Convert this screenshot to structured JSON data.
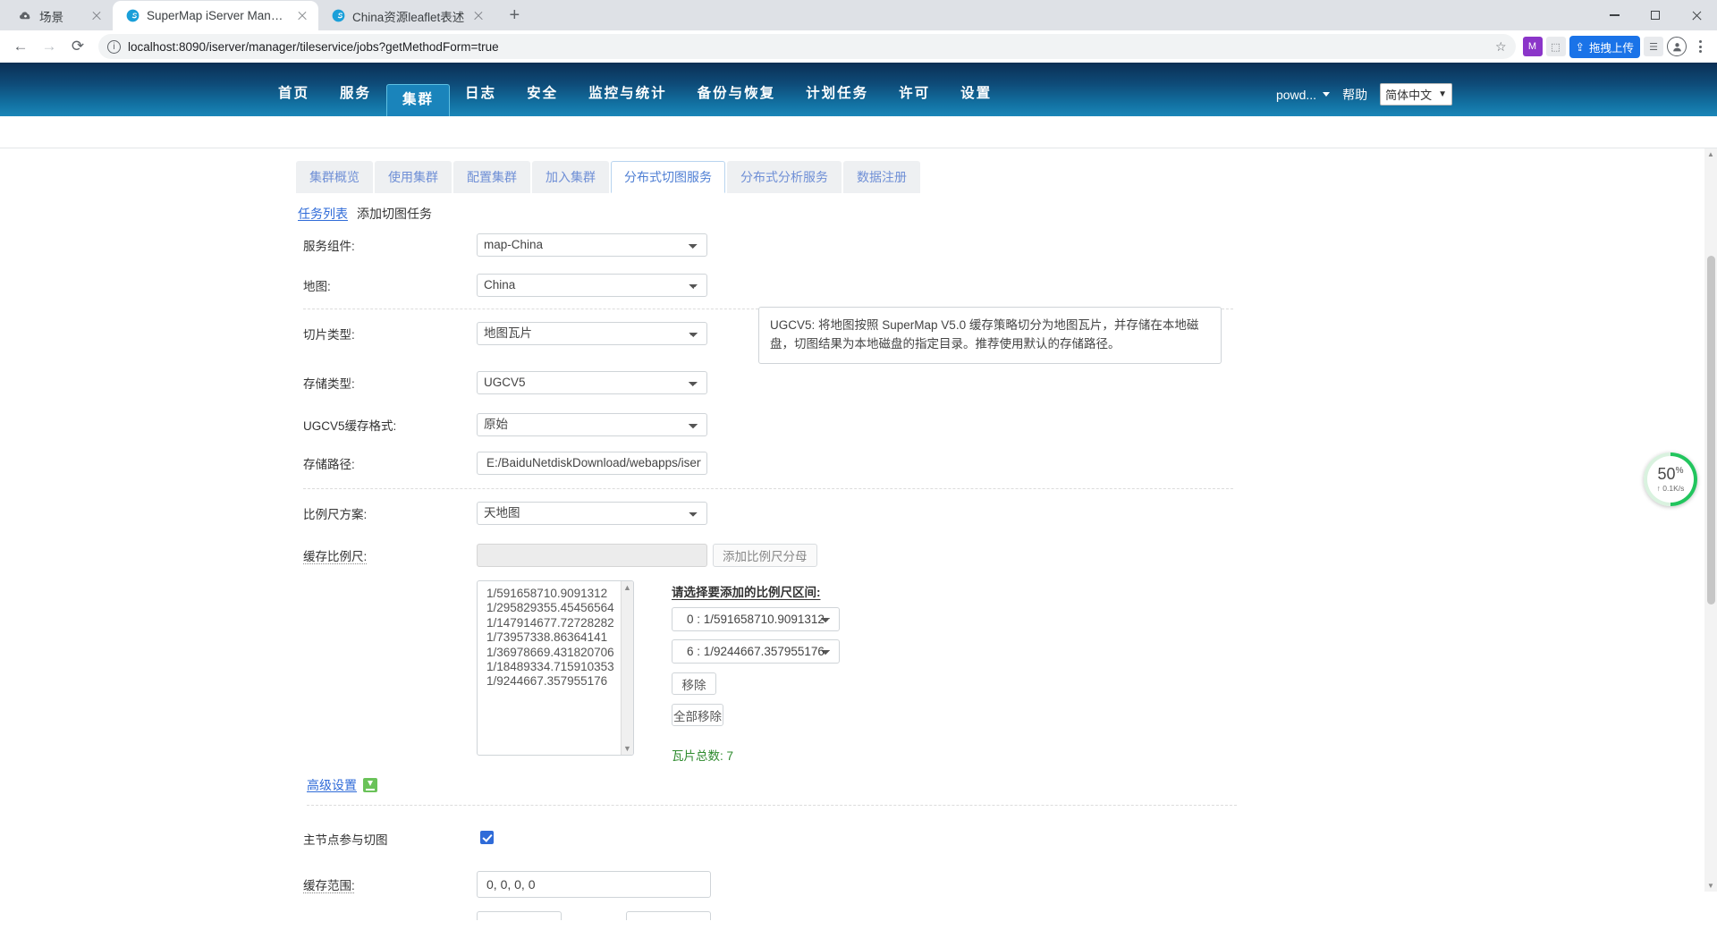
{
  "browser": {
    "tabs": [
      {
        "title": "场景",
        "favicon": "cloud-icon",
        "active": false
      },
      {
        "title": "SuperMap iServer Manager",
        "favicon": "supermap-icon",
        "active": true
      },
      {
        "title": "China资源leaflet表述",
        "favicon": "supermap-icon",
        "active": false
      }
    ],
    "new_tab_label": "+",
    "url": "localhost:8090/iserver/manager/tileservice/jobs?getMethodForm=true",
    "upload_button_label": "拖拽上传",
    "window_controls": {
      "minimize": "minimize-icon",
      "maximize": "maximize-icon",
      "close": "close-icon"
    }
  },
  "app_header": {
    "nav": [
      {
        "label": "首页",
        "active": false
      },
      {
        "label": "服务",
        "active": false
      },
      {
        "label": "集群",
        "active": true
      },
      {
        "label": "日志",
        "active": false
      },
      {
        "label": "安全",
        "active": false
      },
      {
        "label": "监控与统计",
        "active": false
      },
      {
        "label": "备份与恢复",
        "active": false
      },
      {
        "label": "计划任务",
        "active": false
      },
      {
        "label": "许可",
        "active": false
      },
      {
        "label": "设置",
        "active": false
      }
    ],
    "user": "powd...",
    "help": "帮助",
    "language": "简体中文"
  },
  "tabbar": [
    {
      "label": "集群概览",
      "active": false
    },
    {
      "label": "使用集群",
      "active": false
    },
    {
      "label": "配置集群",
      "active": false
    },
    {
      "label": "加入集群",
      "active": false
    },
    {
      "label": "分布式切图服务",
      "active": true
    },
    {
      "label": "分布式分析服务",
      "active": false
    },
    {
      "label": "数据注册",
      "active": false
    }
  ],
  "subnav": {
    "link": "任务列表",
    "current": "添加切图任务"
  },
  "form": {
    "service_component": {
      "label": "服务组件:",
      "value": "map-China"
    },
    "map": {
      "label": "地图:",
      "value": "China"
    },
    "tile_type": {
      "label": "切片类型:",
      "value": "地图瓦片"
    },
    "storage_type": {
      "label": "存储类型:",
      "value": "UGCV5"
    },
    "ugcv5_format": {
      "label": "UGCV5缓存格式:",
      "value": "原始"
    },
    "storage_path": {
      "label": "存储路径:",
      "value": "E:/BaiduNetdiskDownload/webapps/iserver"
    },
    "scale_scheme": {
      "label": "比例尺方案:",
      "value": "天地图"
    },
    "cache_scale": {
      "label": "缓存比例尺:",
      "value": "",
      "add_button": "添加比例尺分母"
    },
    "advanced_link": "高级设置",
    "master_node": {
      "label": "主节点参与切图",
      "checked": true
    },
    "cache_bounds": {
      "label": "缓存范围:",
      "value": "0, 0, 0, 0"
    }
  },
  "tooltip": {
    "text": "UGCV5: 将地图按照 SuperMap V5.0 缓存策略切分为地图瓦片，并存储在本地磁盘，切图结果为本地磁盘的指定目录。推荐使用默认的存储路径。"
  },
  "scale_list": [
    "1/591658710.9091312",
    "1/295829355.45456564",
    "1/147914677.72728282",
    "1/73957338.86364141",
    "1/36978669.431820706",
    "1/18489334.715910353",
    "1/9244667.357955176"
  ],
  "scale_range": {
    "title": "请选择要添加的比例尺区间:",
    "from": "0 : 1/591658710.9091312",
    "to": "6 : 1/9244667.357955176",
    "remove_button": "移除",
    "remove_all_button": "全部移除",
    "tile_total_label": "瓦片总数: 7",
    "tile_total_color": "#2e8b2e"
  },
  "progress_widget": {
    "percent": "50",
    "percent_symbol": "%",
    "speed": "↑ 0.1K/s",
    "ring_color": "#22c55e"
  }
}
